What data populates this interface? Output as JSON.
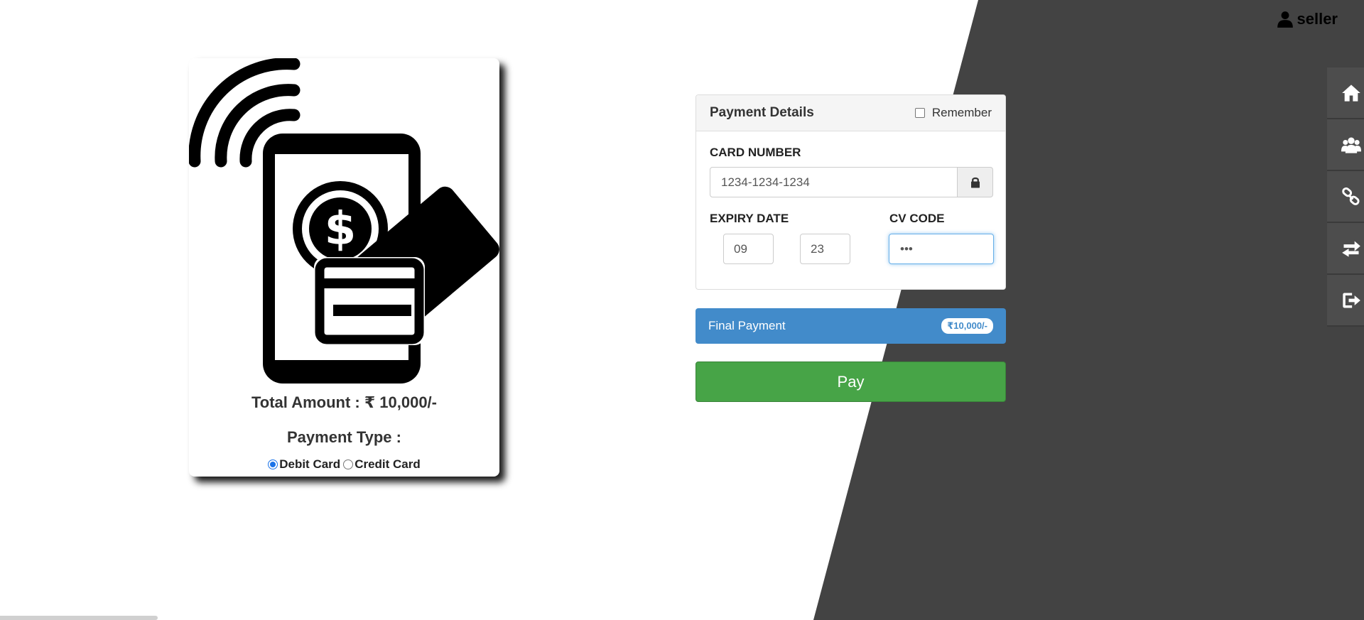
{
  "header": {
    "user_name": "seller",
    "user_icon": "user-icon"
  },
  "side_nav": [
    {
      "icon": "home-icon"
    },
    {
      "icon": "users-icon"
    },
    {
      "icon": "link-icon"
    },
    {
      "icon": "exchange-icon"
    },
    {
      "icon": "logout-icon"
    }
  ],
  "payment_card": {
    "illustration": "mobile-payment-illustration",
    "total_amount": "Total Amount : ₹ 10,000/-",
    "payment_type_label": "Payment Type :",
    "options": [
      {
        "label": "Debit Card",
        "checked": true
      },
      {
        "label": "Credit Card",
        "checked": false
      }
    ]
  },
  "payment_details": {
    "title": "Payment Details",
    "remember_label": "Remember",
    "card_number_label": "CARD NUMBER",
    "card_number_value": "1234-1234-1234",
    "expiry_label": "EXPIRY DATE",
    "expiry_month": "09",
    "expiry_year": "23",
    "cv_label": "CV CODE",
    "cv_value": "•••"
  },
  "final_payment": {
    "label": "Final Payment",
    "amount": "₹10,000/-"
  },
  "pay_button": {
    "label": "Pay"
  },
  "colors": {
    "dark_bg": "#434343",
    "primary": "#428bca",
    "success": "#47a447",
    "nav_bg": "#4d4d4d"
  }
}
